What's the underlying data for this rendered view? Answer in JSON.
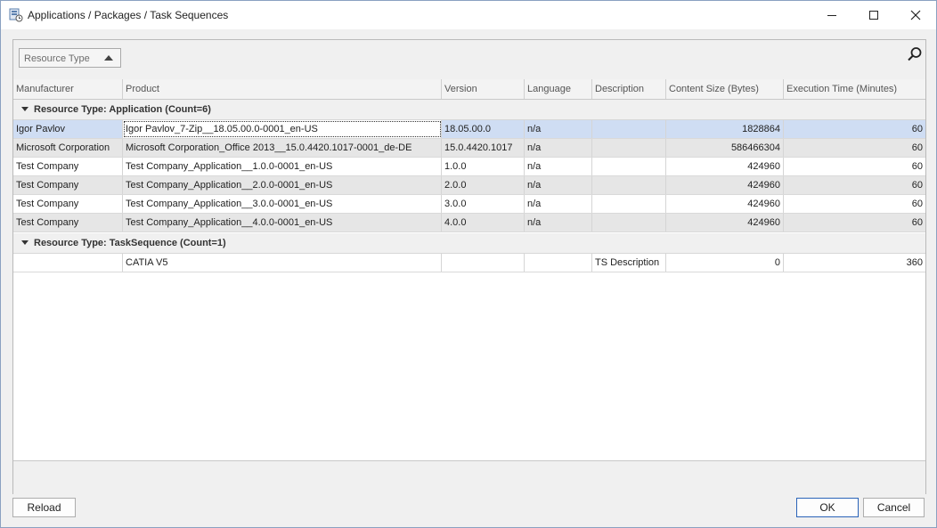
{
  "window": {
    "title": "Applications / Packages / Task Sequences"
  },
  "group_panel": {
    "chip_label": "Resource Type"
  },
  "columns": [
    "Manufacturer",
    "Product",
    "Version",
    "Language",
    "Description",
    "Content Size (Bytes)",
    "Execution Time (Minutes)"
  ],
  "groups": [
    {
      "label": "Resource Type: Application (Count=6)",
      "rows": [
        [
          "Igor Pavlov",
          "Igor Pavlov_7-Zip__18.05.00.0-0001_en-US",
          "18.05.00.0",
          "n/a",
          "",
          "1828864",
          "60"
        ],
        [
          "Microsoft Corporation",
          "Microsoft Corporation_Office 2013__15.0.4420.1017-0001_de-DE",
          "15.0.4420.1017",
          "n/a",
          "",
          "586466304",
          "60"
        ],
        [
          "Test Company",
          "Test Company_Application__1.0.0-0001_en-US",
          "1.0.0",
          "n/a",
          "",
          "424960",
          "60"
        ],
        [
          "Test Company",
          "Test Company_Application__2.0.0-0001_en-US",
          "2.0.0",
          "n/a",
          "",
          "424960",
          "60"
        ],
        [
          "Test Company",
          "Test Company_Application__3.0.0-0001_en-US",
          "3.0.0",
          "n/a",
          "",
          "424960",
          "60"
        ],
        [
          "Test Company",
          "Test Company_Application__4.0.0-0001_en-US",
          "4.0.0",
          "n/a",
          "",
          "424960",
          "60"
        ]
      ]
    },
    {
      "label": "Resource Type: TaskSequence (Count=1)",
      "rows": [
        [
          "",
          "CATIA V5",
          "",
          "",
          "TS Description",
          "0",
          "360"
        ]
      ]
    }
  ],
  "buttons": {
    "reload": "Reload",
    "ok": "OK",
    "cancel": "Cancel"
  },
  "icons": {
    "app": "app-grid-icon",
    "minimize": "minimize-icon",
    "maximize": "maximize-icon",
    "close": "close-icon",
    "search": "search-icon",
    "sort": "sort-ascending-icon",
    "collapse": "collapse-icon"
  },
  "colors": {
    "selected_row": "#cfddf3",
    "alt_row": "#e6e6e6",
    "primary_border": "#2a63b8"
  }
}
